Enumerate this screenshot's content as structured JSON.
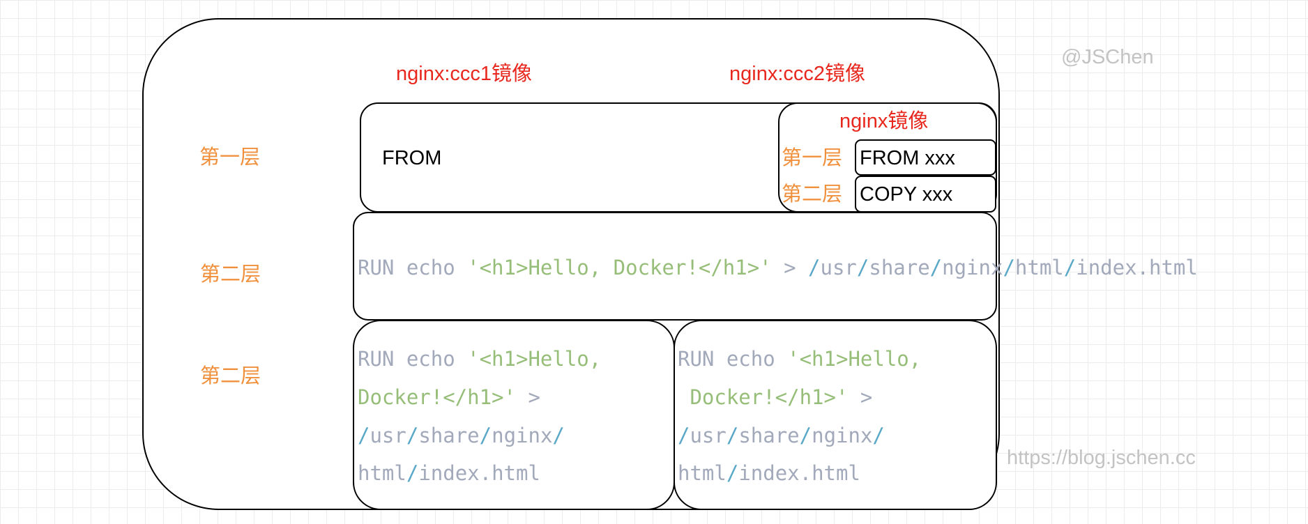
{
  "watermark": {
    "author": "@JSChen",
    "url": "https://blog.jschen.cc"
  },
  "images": {
    "ccc1_title": "nginx:ccc1镜像",
    "ccc2_title": "nginx:ccc2镜像",
    "nginx_title": "nginx镜像"
  },
  "layers": {
    "row1": "第一层",
    "row2": "第二层",
    "row3": "第二层"
  },
  "from_box": {
    "text": "FROM"
  },
  "nginx_layers": {
    "layer1_label": "第一层",
    "layer1_cmd": "FROM xxx",
    "layer2_label": "第二层",
    "layer2_cmd": "COPY xxx"
  },
  "shared_run": {
    "kw": "RUN echo ",
    "str": "'<h1>Hello, Docker!</h1>'",
    "gt": " > ",
    "sep": "/",
    "usr": "usr",
    "share": "share",
    "nginx": "nginx",
    "html": "html",
    "file": "index.html"
  },
  "left_run": {
    "kw": "RUN echo ",
    "str1": "'<h1>Hello,",
    "str2": "Docker!</h1>'",
    "gt": " >",
    "sep": "/",
    "usr": "usr",
    "share": "share",
    "nginx": "nginx",
    "html": "html",
    "file": "index.html"
  },
  "right_run": {
    "kw": "RUN echo ",
    "str1": "'<h1>Hello,",
    "str2": " Docker!</h1>'",
    "gt": " >",
    "sep": "/",
    "usr": "usr",
    "share": "share",
    "nginx": "nginx",
    "html": "html",
    "file": "index.html"
  }
}
